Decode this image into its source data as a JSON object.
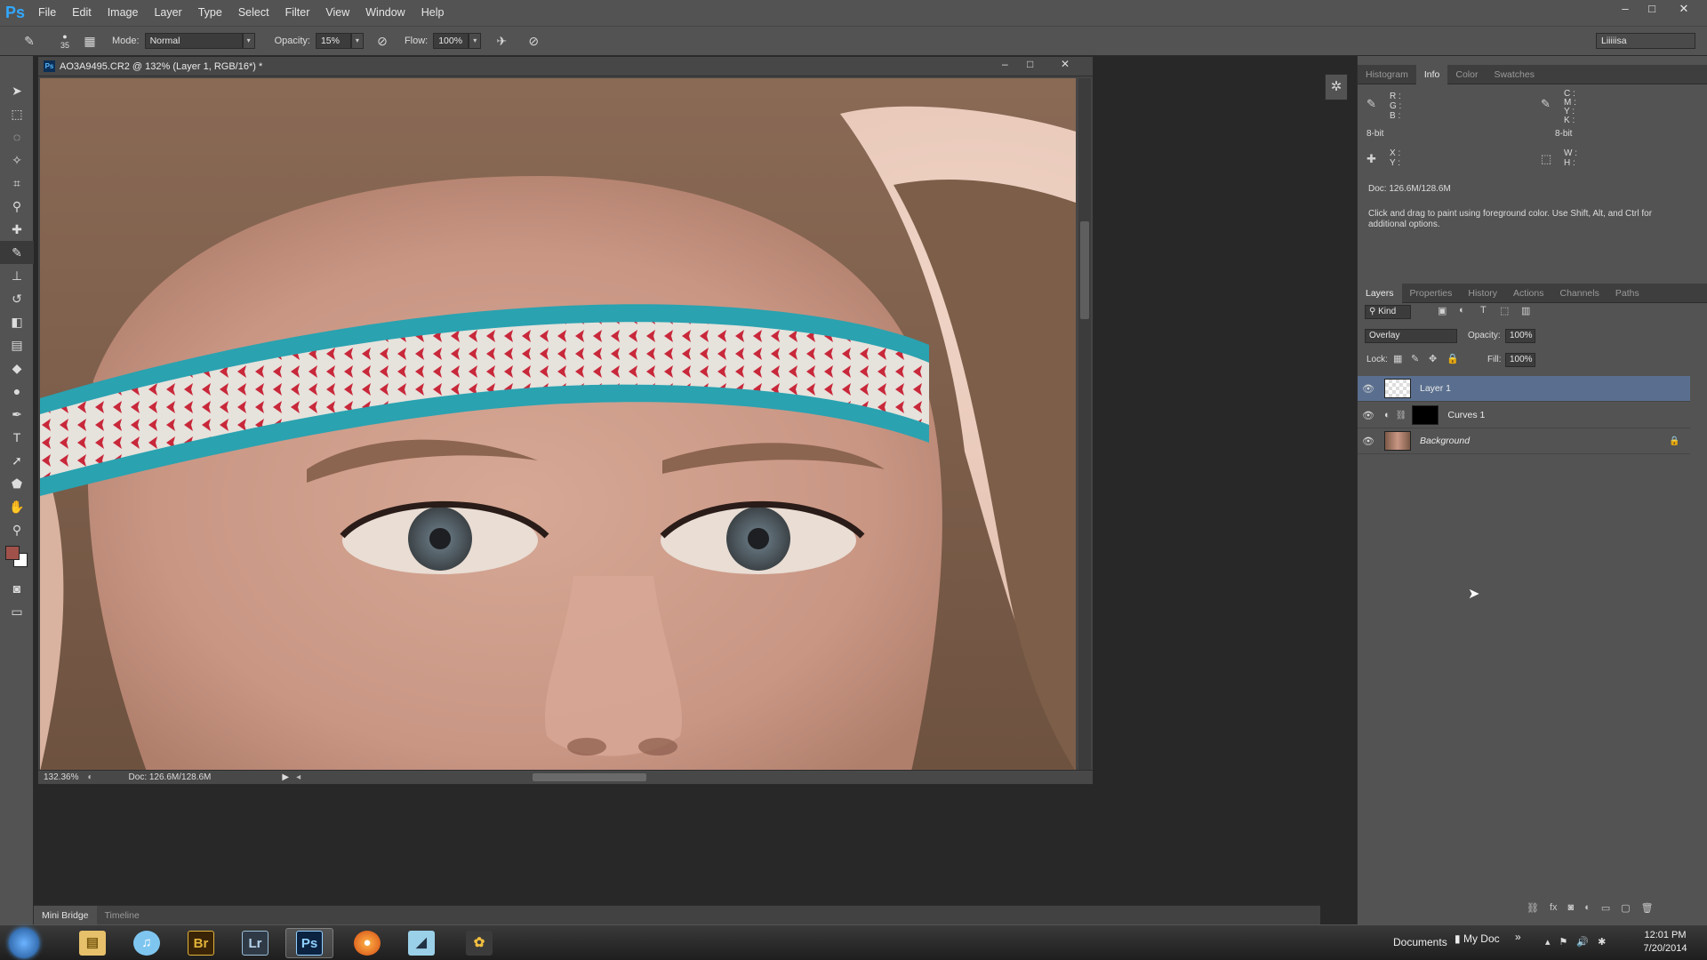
{
  "app": {
    "logo": "Ps"
  },
  "menu": [
    "File",
    "Edit",
    "Image",
    "Layer",
    "Type",
    "Select",
    "Filter",
    "View",
    "Window",
    "Help"
  ],
  "window_controls": {
    "min": "–",
    "max": "□",
    "close": "✕"
  },
  "options": {
    "brush_size": "35",
    "mode_label": "Mode:",
    "mode_value": "Normal",
    "opacity_label": "Opacity:",
    "opacity_value": "15%",
    "flow_label": "Flow:",
    "flow_value": "100%",
    "workspace": "Liiiiisa"
  },
  "document": {
    "tab_title": "AO3A9495.CR2 @ 132% (Layer 1, RGB/16*) *",
    "zoom": "132.36%",
    "doc_size": "Doc: 126.6M/128.6M"
  },
  "bottom_tabs": [
    "Mini Bridge",
    "Timeline"
  ],
  "info_panel": {
    "tabs": [
      "Histogram",
      "Info",
      "Color",
      "Swatches"
    ],
    "active_tab": "Info",
    "rgb_labels": "R :\nG :\nB :",
    "cmyk_labels": "C :\nM :\nY :\nK :",
    "bit_left": "8-bit",
    "bit_right": "8-bit",
    "xy_labels": "X :\nY :",
    "wh_labels": "W :\nH :",
    "doc": "Doc: 126.6M/128.6M",
    "hint": "Click and drag to paint using foreground color.  Use Shift, Alt, and Ctrl for additional options."
  },
  "layers_panel": {
    "tabs": [
      "Layers",
      "Properties",
      "History",
      "Actions",
      "Channels",
      "Paths"
    ],
    "active_tab": "Layers",
    "filter_kind": "Kind",
    "blend_mode": "Overlay",
    "opacity_label": "Opacity:",
    "opacity_value": "100%",
    "lock_label": "Lock:",
    "fill_label": "Fill:",
    "fill_value": "100%",
    "layers": [
      {
        "name": "Layer 1",
        "selected": true
      },
      {
        "name": "Curves 1",
        "selected": false
      },
      {
        "name": "Background",
        "selected": false
      }
    ]
  },
  "taskbar": {
    "apps": [
      "Br",
      "Lr",
      "Ps"
    ],
    "documents": "Documents",
    "mydoc": "My Doc",
    "chevron": "»",
    "time": "12:01 PM",
    "date": "7/20/2014"
  },
  "colors": {
    "ui_dark": "#535353",
    "selection": "#5a6f8f",
    "foreground_swatch": "#a0524a",
    "background_swatch": "#ffffff"
  }
}
